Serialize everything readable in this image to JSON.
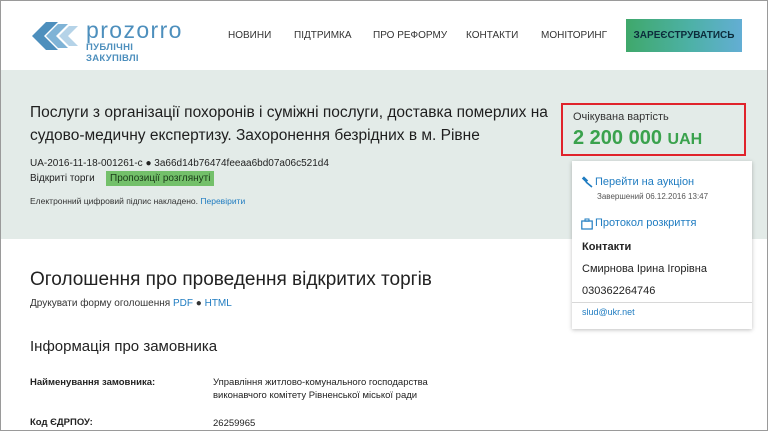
{
  "header": {
    "logo_word": "prozorro",
    "logo_sub": "ПУБЛІЧНІ ЗАКУПІВЛІ",
    "nav": [
      "НОВИНИ",
      "ПІДТРИМКА",
      "ПРО РЕФОРМУ",
      "КОНТАКТИ",
      "МОНІТОРИНГ"
    ],
    "register_label": "ЗАРЕЄСТРУВАТИСЬ"
  },
  "tender": {
    "title": "Послуги з організації похоронів і суміжні послуги, доставка померлих на судово-медичну експертизу. Захоронення безрідних в м. Рівне",
    "id_line": "UA-2016-11-18-001261-c ● 3a66d14b76474feeaa6bd07a06c521d4",
    "procedure_type": "Відкриті торги",
    "status": "Пропозиції розглянуті",
    "signature_text": "Електронний цифровий підпис накладено.",
    "signature_link": "Перевірити"
  },
  "value": {
    "label": "Очікувана вартість",
    "amount": "2 200 000",
    "currency": "UAH"
  },
  "side": {
    "auction_link": "Перейти на аукціон",
    "auction_finished": "Завершений 06.12.2016 13:47",
    "protocol_link": "Протокол розкриття",
    "contacts_title": "Контакти",
    "contact_name": "Смирнова Ірина Ігорівна",
    "contact_phone": "030362264746",
    "contact_email": "slud@ukr.net"
  },
  "main": {
    "title": "Оголошення про проведення відкритих торгів",
    "print_text": "Друкувати форму оголошення",
    "pdf": "PDF",
    "sep": "●",
    "html": "HTML",
    "section_title": "Інформація про замовника",
    "fields": [
      {
        "label": "Найменування замовника:",
        "value": "Управління житлово-комунального господарства виконавчого комітету Рівненської міської ради"
      },
      {
        "label": "Код ЄДРПОУ:",
        "value": "26259965"
      }
    ]
  },
  "colors": {
    "brand_blue": "#4d8fbd",
    "link": "#1f7cc1",
    "value_green": "#3aa24d",
    "highlight_red": "#e0232b",
    "status_green": "#73c06a",
    "panel_bg": "#e3ebe8"
  }
}
